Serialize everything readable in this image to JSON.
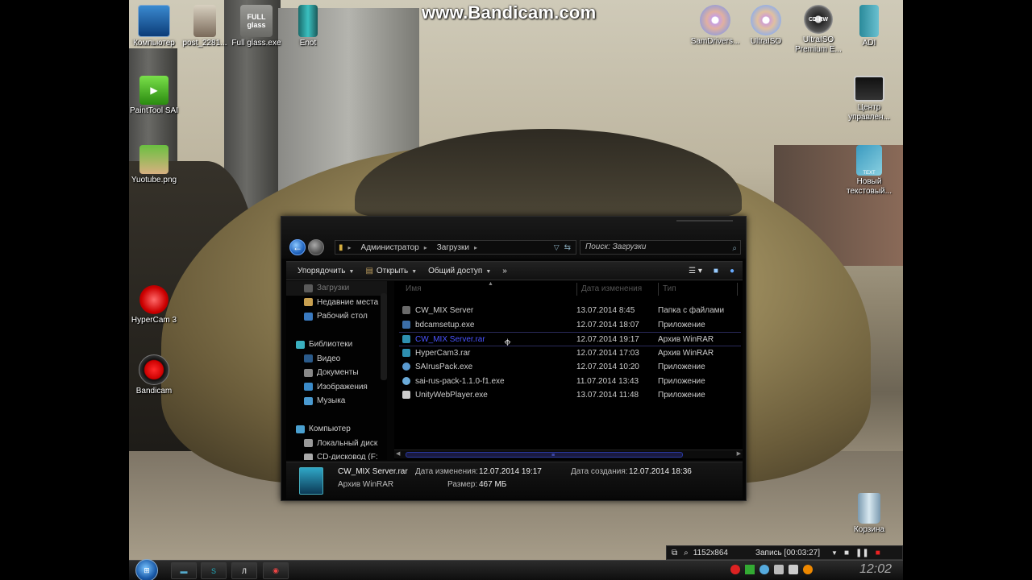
{
  "watermark": "www.Bandicam.com",
  "desktop_icons": [
    {
      "label": "Компьютер",
      "icon": "computer-icon"
    },
    {
      "label": "post_2281...",
      "icon": "image-icon"
    },
    {
      "label": "Full glass.exe",
      "icon": "app-icon",
      "glyph": "FULL glass"
    },
    {
      "label": "Enot",
      "icon": "app-icon"
    },
    {
      "label": "PaintTool SAI",
      "icon": "painttool-icon"
    },
    {
      "label": "Yuotube.png",
      "icon": "image-icon"
    },
    {
      "label": "HyperCam 3",
      "icon": "record-icon"
    },
    {
      "label": "Bandicam",
      "icon": "record-icon"
    },
    {
      "label": "SamDrivers...",
      "icon": "disc-icon"
    },
    {
      "label": "UltraISO",
      "icon": "disc-icon"
    },
    {
      "label": "UltraISO Premium E...",
      "icon": "disc-icon",
      "glyph": "CD-RW"
    },
    {
      "label": "ADI",
      "icon": "app-icon"
    },
    {
      "label": "Центр управлен...",
      "icon": "control-center-icon"
    },
    {
      "label": "Новый текстовый...",
      "icon": "text-file-icon",
      "glyph": "TEXT"
    },
    {
      "label": "Корзина",
      "icon": "recycle-bin-icon"
    }
  ],
  "explorer": {
    "breadcrumb": [
      "Администратор",
      "Загрузки"
    ],
    "search_placeholder": "Поиск: Загрузки",
    "toolbar": {
      "organize": "Упорядочить",
      "open": "Открыть",
      "share": "Общий доступ",
      "more": "»"
    },
    "nav_pane": {
      "favorites": [
        {
          "label": "Загрузки",
          "icon": "downloads-icon"
        },
        {
          "label": "Недавние места",
          "icon": "recent-places-icon"
        },
        {
          "label": "Рабочий стол",
          "icon": "desktop-icon"
        }
      ],
      "libraries_label": "Библиотеки",
      "libraries": [
        {
          "label": "Видео",
          "icon": "video-icon"
        },
        {
          "label": "Документы",
          "icon": "documents-icon"
        },
        {
          "label": "Изображения",
          "icon": "pictures-icon"
        },
        {
          "label": "Музыка",
          "icon": "music-icon"
        }
      ],
      "computer_label": "Компьютер",
      "drives": [
        {
          "label": "Локальный диск",
          "icon": "drive-icon"
        },
        {
          "label": "CD-дисковод (F:",
          "icon": "cd-drive-icon"
        }
      ]
    },
    "columns": {
      "name": "Имя",
      "date": "Дата изменения",
      "type": "Тип"
    },
    "files": [
      {
        "name": "CW_MIX Server",
        "date": "13.07.2014 8:45",
        "type": "Папка с файлами",
        "icon": "folder-icon",
        "color": "#6a6a6a"
      },
      {
        "name": "bdcamsetup.exe",
        "date": "12.07.2014 18:07",
        "type": "Приложение",
        "icon": "exe-icon",
        "color": "#3b6ea8"
      },
      {
        "name": "CW_MIX Server.rar",
        "date": "12.07.2014 19:17",
        "type": "Архив WinRAR",
        "icon": "rar-icon",
        "color": "#2e8fb0",
        "selected": true
      },
      {
        "name": "HyperCam3.rar",
        "date": "12.07.2014 17:03",
        "type": "Архив WinRAR",
        "icon": "rar-icon",
        "color": "#2e8fb0"
      },
      {
        "name": "SAIrusPack.exe",
        "date": "12.07.2014 10:20",
        "type": "Приложение",
        "icon": "exe-icon",
        "color": "#5a9ad0"
      },
      {
        "name": "sai-rus-pack-1.1.0-f1.exe",
        "date": "11.07.2014 13:43",
        "type": "Приложение",
        "icon": "exe-icon",
        "color": "#6aaad8"
      },
      {
        "name": "UnityWebPlayer.exe",
        "date": "13.07.2014 11:48",
        "type": "Приложение",
        "icon": "unity-icon",
        "color": "#cccccc"
      }
    ],
    "details": {
      "file_name": "CW_MIX Server.rar",
      "file_type": "Архив WinRAR",
      "modified_label": "Дата изменения:",
      "modified_value": "12.07.2014 19:17",
      "created_label": "Дата создания:",
      "created_value": "12.07.2014 18:36",
      "size_label": "Размер:",
      "size_value": "467 МБ"
    }
  },
  "recording_bar": {
    "resolution": "1152x864",
    "status": "Запись [00:03:27]"
  },
  "taskbar": {
    "clock": "12:02",
    "buttons": [
      "explorer-icon",
      "skype-icon",
      "lightshot-icon",
      "chrome-icon"
    ]
  }
}
